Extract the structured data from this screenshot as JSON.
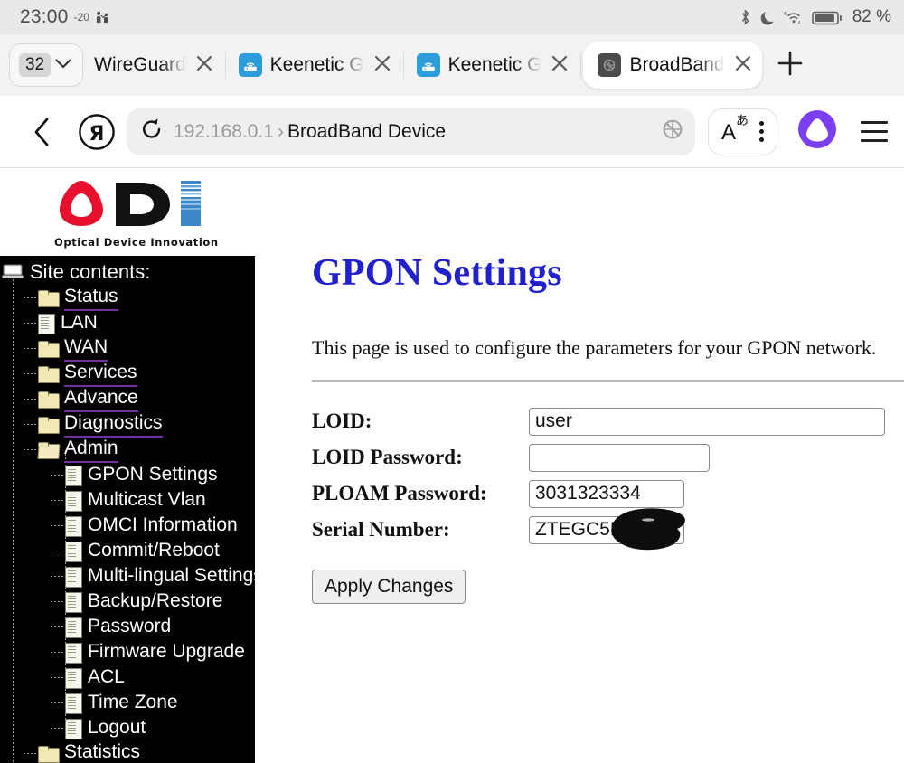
{
  "statusbar": {
    "clock": "23:00",
    "temperature": "-20",
    "app_icon": "contacts-icon",
    "icons": [
      "bluetooth-icon",
      "do-not-disturb-moon-icon",
      "wifi-6-icon",
      "battery-icon"
    ],
    "battery_percent": "82 %"
  },
  "tabstrip": {
    "tab_count": "32",
    "dropdown_icon": "chevron-down-icon",
    "new_tab_icon": "plus-icon",
    "tabs": [
      {
        "title": "WireGuard",
        "favicon": "none",
        "active": false
      },
      {
        "title": "Keenetic G",
        "favicon": "router-icon",
        "active": false
      },
      {
        "title": "Keenetic G",
        "favicon": "router-icon",
        "active": false
      },
      {
        "title": "BroadBand",
        "favicon": "broadband-device-icon",
        "active": true
      }
    ],
    "close_icon": "close-icon"
  },
  "addressbar": {
    "back_icon": "back-chevron-icon",
    "browser_logo": "yandex-logo-icon",
    "reload_icon": "reload-icon",
    "host": "192.168.0.1",
    "separator": "›",
    "page_name": "BroadBand Device",
    "shield_icon": "adblock-shield-icon",
    "translate_label": "A",
    "translate_sup": "あ",
    "more_icon": "three-dots-icon",
    "assistant_icon": "alice-assistant-icon",
    "menu_icon": "hamburger-menu-icon"
  },
  "brand": {
    "letters": "ODi",
    "tagline": "Optical Device Innovation",
    "colors": {
      "o_red": "#e8112d",
      "d_black": "#111111",
      "i_blue": "#3b87c8"
    }
  },
  "sidebar": {
    "root_label": "Site contents:",
    "root_icon": "computer-icon",
    "items": [
      {
        "label": "Status",
        "level": 1,
        "icon": "folder-icon",
        "link": true
      },
      {
        "label": "LAN",
        "level": 1,
        "icon": "page-icon",
        "link": false
      },
      {
        "label": "WAN",
        "level": 1,
        "icon": "folder-icon",
        "link": true
      },
      {
        "label": "Services",
        "level": 1,
        "icon": "folder-icon",
        "link": true
      },
      {
        "label": "Advance",
        "level": 1,
        "icon": "folder-icon",
        "link": true
      },
      {
        "label": "Diagnostics",
        "level": 1,
        "icon": "folder-icon",
        "link": true
      },
      {
        "label": "Admin",
        "level": 1,
        "icon": "folder-open-icon",
        "link": true
      },
      {
        "label": "GPON Settings",
        "level": 2,
        "icon": "page-icon",
        "link": false
      },
      {
        "label": "Multicast Vlan",
        "level": 2,
        "icon": "page-icon",
        "link": false
      },
      {
        "label": "OMCI Information",
        "level": 2,
        "icon": "page-icon",
        "link": false
      },
      {
        "label": "Commit/Reboot",
        "level": 2,
        "icon": "page-icon",
        "link": false
      },
      {
        "label": "Multi-lingual Settings",
        "level": 2,
        "icon": "page-icon",
        "link": false
      },
      {
        "label": "Backup/Restore",
        "level": 2,
        "icon": "page-icon",
        "link": false
      },
      {
        "label": "Password",
        "level": 2,
        "icon": "page-icon",
        "link": false
      },
      {
        "label": "Firmware Upgrade",
        "level": 2,
        "icon": "page-icon",
        "link": false
      },
      {
        "label": "ACL",
        "level": 2,
        "icon": "page-icon",
        "link": false
      },
      {
        "label": "Time Zone",
        "level": 2,
        "icon": "page-icon",
        "link": false
      },
      {
        "label": "Logout",
        "level": 2,
        "icon": "page-icon",
        "link": false
      },
      {
        "label": "Statistics",
        "level": 1,
        "icon": "folder-icon",
        "link": true
      }
    ]
  },
  "main": {
    "title": "GPON Settings",
    "title_color": "#2020cc",
    "description": "This page is used to configure the parameters for your GPON network.",
    "fields": [
      {
        "label": "LOID:",
        "value": "user",
        "width": "w-loid",
        "redacted": false
      },
      {
        "label": "LOID Password:",
        "value": "",
        "width": "w-loidpw",
        "redacted": false
      },
      {
        "label": "PLOAM Password:",
        "value": "3031323334",
        "width": "w-ploam",
        "redacted": false
      },
      {
        "label": "Serial Number:",
        "value": "ZTEGC5B",
        "width": "w-serial",
        "redacted": true
      }
    ],
    "apply_label": "Apply Changes"
  }
}
